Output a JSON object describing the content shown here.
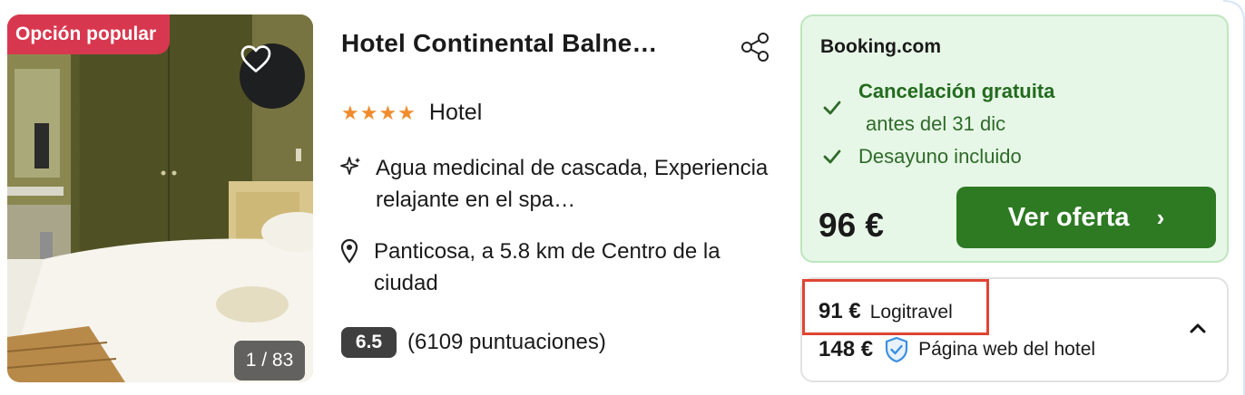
{
  "listing": {
    "badge": "Opción popular",
    "photo_counter": "1 / 83",
    "title": "Hotel Continental Balne…",
    "stars": "★★★★",
    "stars_count": 4,
    "type": "Hotel",
    "amenities": "Agua medicinal de cascada, Experiencia relajante en el spa…",
    "location": "Panticosa, a 5.8 km de Centro de la ciudad",
    "rating_score": "6.5",
    "rating_reviews": "(6109 puntuaciones)"
  },
  "featured_offer": {
    "provider": "Booking.com",
    "cancellation_title": "Cancelación gratuita",
    "cancellation_sub": "antes del 31 dic",
    "breakfast": "Desayuno incluido",
    "price": "96 €",
    "cta_label": "Ver oferta",
    "cta_arrow": "›"
  },
  "other_offers": [
    {
      "price": "91 €",
      "provider": "Logitravel"
    },
    {
      "price": "148 €",
      "provider": "Página web del hotel"
    }
  ],
  "icons": {
    "heart": "heart-icon",
    "share": "share-icon",
    "sparkle": "sparkle-icon",
    "pin": "map-pin-icon",
    "check": "check-icon",
    "shield": "shield-check-icon",
    "chevron": "chevron-up-icon"
  },
  "colors": {
    "badge_bg": "#d8384f",
    "offer_bg": "#e7f7e7",
    "cta_bg": "#2d7a22",
    "check_green": "#2e6b29",
    "star_orange": "#f08c2e",
    "highlight_red": "#e04533",
    "shield_blue": "#3d8fe0"
  }
}
